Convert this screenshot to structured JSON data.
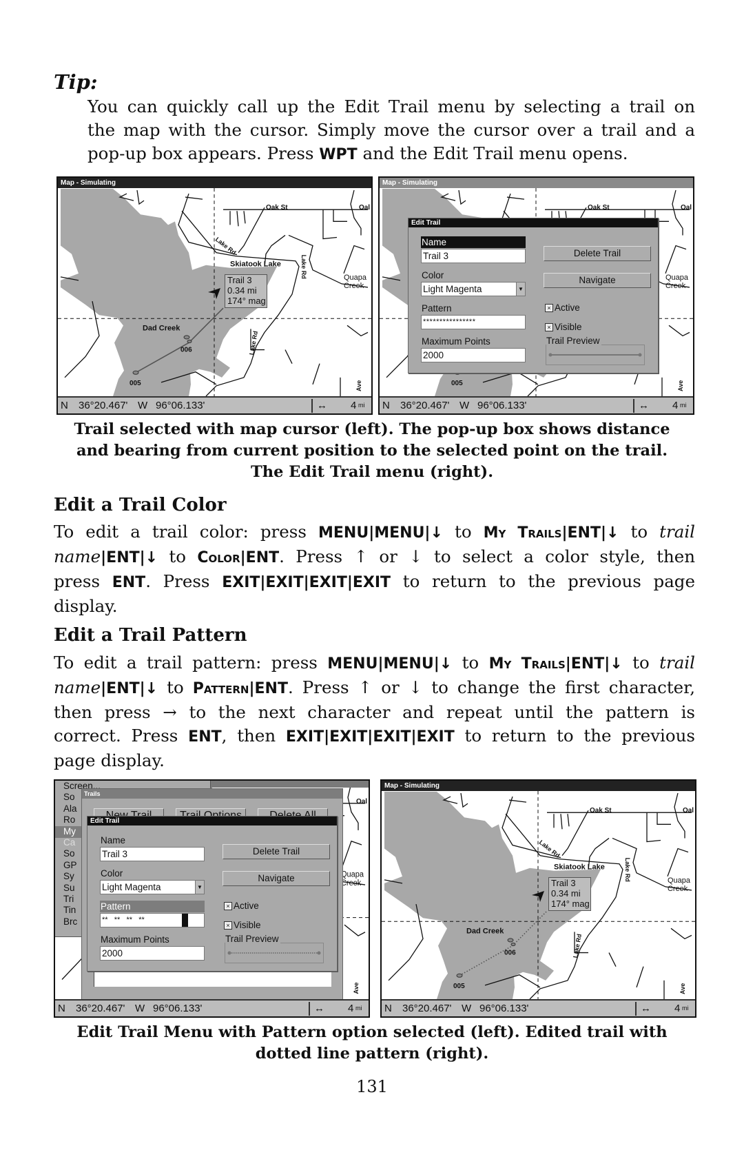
{
  "tip": {
    "title": "Tip:",
    "lines": [
      [
        {
          "t": "You can quickly call up the Edit Trail menu by selecting a trail on"
        }
      ],
      [
        {
          "t": "the map with the cursor. Simply move the cursor over a trail and a"
        }
      ],
      [
        {
          "t": "pop-up box appears. Press "
        },
        {
          "t": "WPT",
          "s": "k"
        },
        {
          "t": " and the Edit Trail menu opens."
        }
      ]
    ]
  },
  "map": {
    "title": "Map - Simulating",
    "labels": {
      "oak_st": "Oak St",
      "oal": "Oal",
      "skiatook_lake": "Skiatook Lake",
      "lake_rd": "Lake Rd",
      "quapa": "Quapa",
      "creek": "Creek",
      "dad_creek": "Dad Creek",
      "wp_006": "006",
      "wp_005": "005",
      "ave": "Ave"
    },
    "popup": {
      "name": "Trail 3",
      "distance": "0.34 mi",
      "bearing": "174° mag"
    },
    "status": {
      "lat_hemi": "N",
      "lat": "36°20.467'",
      "lon_hemi": "W",
      "lon": "96°06.133'",
      "scale_icon": "↔",
      "scale": "4",
      "scale_unit": "mi"
    }
  },
  "edit_trail": {
    "title": "Edit Trail",
    "name_label": "Name",
    "name_value": "Trail 3",
    "color_label": "Color",
    "color_value": "Light Magenta",
    "pattern_label": "Pattern",
    "pattern_value_solid": "****************",
    "pattern_value_dotted": "**   **   **   **",
    "max_points_label": "Maximum Points",
    "max_points_value": "2000",
    "delete_button": "Delete Trail",
    "navigate_button": "Navigate",
    "active_label": "Active",
    "active_checked": true,
    "visible_label": "Visible",
    "visible_checked": true,
    "preview_label": "Trail Preview",
    "checkbox_mark": "×"
  },
  "trails_window": {
    "title": "Trails",
    "buttons": [
      "New Trail",
      "Trail Options",
      "Delete All"
    ]
  },
  "main_menu": {
    "items": [
      "Screen...",
      "So",
      "Ala",
      "Ro",
      "My",
      "Ca",
      "So",
      "GP",
      "Sy",
      "Su",
      "Tri",
      "Tin",
      "Brc"
    ],
    "selected": "My",
    "disabled": "Ca"
  },
  "caption_top": [
    "Trail selected with map cursor (left). The pop-up box shows distance",
    "and bearing from current position to the selected point on the trail.",
    "The Edit Trail menu (right)."
  ],
  "section_color": {
    "heading": "Edit a Trail Color",
    "lines": [
      [
        {
          "t": "To edit a trail color: press "
        },
        {
          "t": "MENU|MENU|↓",
          "s": "k"
        },
        {
          "t": " to "
        },
        {
          "t": "My Trails",
          "s": "sc"
        },
        {
          "t": "|ENT|↓",
          "s": "k"
        },
        {
          "t": " to "
        },
        {
          "t": "trail",
          "s": "i"
        }
      ],
      [
        {
          "t": "name",
          "s": "i"
        },
        {
          "t": "|ENT|↓",
          "s": "k"
        },
        {
          "t": " to "
        },
        {
          "t": "Color",
          "s": "sc"
        },
        {
          "t": "|ENT",
          "s": "k"
        },
        {
          "t": ". Press ↑ or ↓ to select a color style, then"
        }
      ],
      [
        {
          "t": "press "
        },
        {
          "t": "ENT",
          "s": "k"
        },
        {
          "t": ". Press "
        },
        {
          "t": "EXIT|EXIT|EXIT|EXIT",
          "s": "k"
        },
        {
          "t": " to return to the previous page"
        }
      ],
      [
        {
          "t": "display."
        }
      ]
    ]
  },
  "section_pattern": {
    "heading": "Edit a Trail Pattern",
    "lines": [
      [
        {
          "t": "To edit a trail pattern: press "
        },
        {
          "t": "MENU|MENU|↓",
          "s": "k"
        },
        {
          "t": " to "
        },
        {
          "t": "My Trails",
          "s": "sc"
        },
        {
          "t": "|ENT|↓",
          "s": "k"
        },
        {
          "t": " to "
        },
        {
          "t": "trail",
          "s": "i"
        }
      ],
      [
        {
          "t": "name",
          "s": "i"
        },
        {
          "t": "|ENT|↓",
          "s": "k"
        },
        {
          "t": " to "
        },
        {
          "t": "Pattern",
          "s": "sc"
        },
        {
          "t": "|ENT",
          "s": "k"
        },
        {
          "t": ". Press ↑ or ↓ to change the first character,"
        }
      ],
      [
        {
          "t": "then press → to the next character and repeat until the pattern is"
        }
      ],
      [
        {
          "t": "correct. Press "
        },
        {
          "t": "ENT",
          "s": "k"
        },
        {
          "t": ", then "
        },
        {
          "t": "EXIT|EXIT|EXIT|EXIT",
          "s": "k"
        },
        {
          "t": " to return to the previous"
        }
      ],
      [
        {
          "t": "page display."
        }
      ]
    ]
  },
  "caption_bottom": [
    "Edit Trail Menu with Pattern option selected (left). Edited trail with",
    "dotted line pattern (right)."
  ],
  "page_number": "131",
  "colors": {
    "lake": "#a8a8a8",
    "dialog": "#a9a9a9",
    "title_bar": "#111111"
  }
}
